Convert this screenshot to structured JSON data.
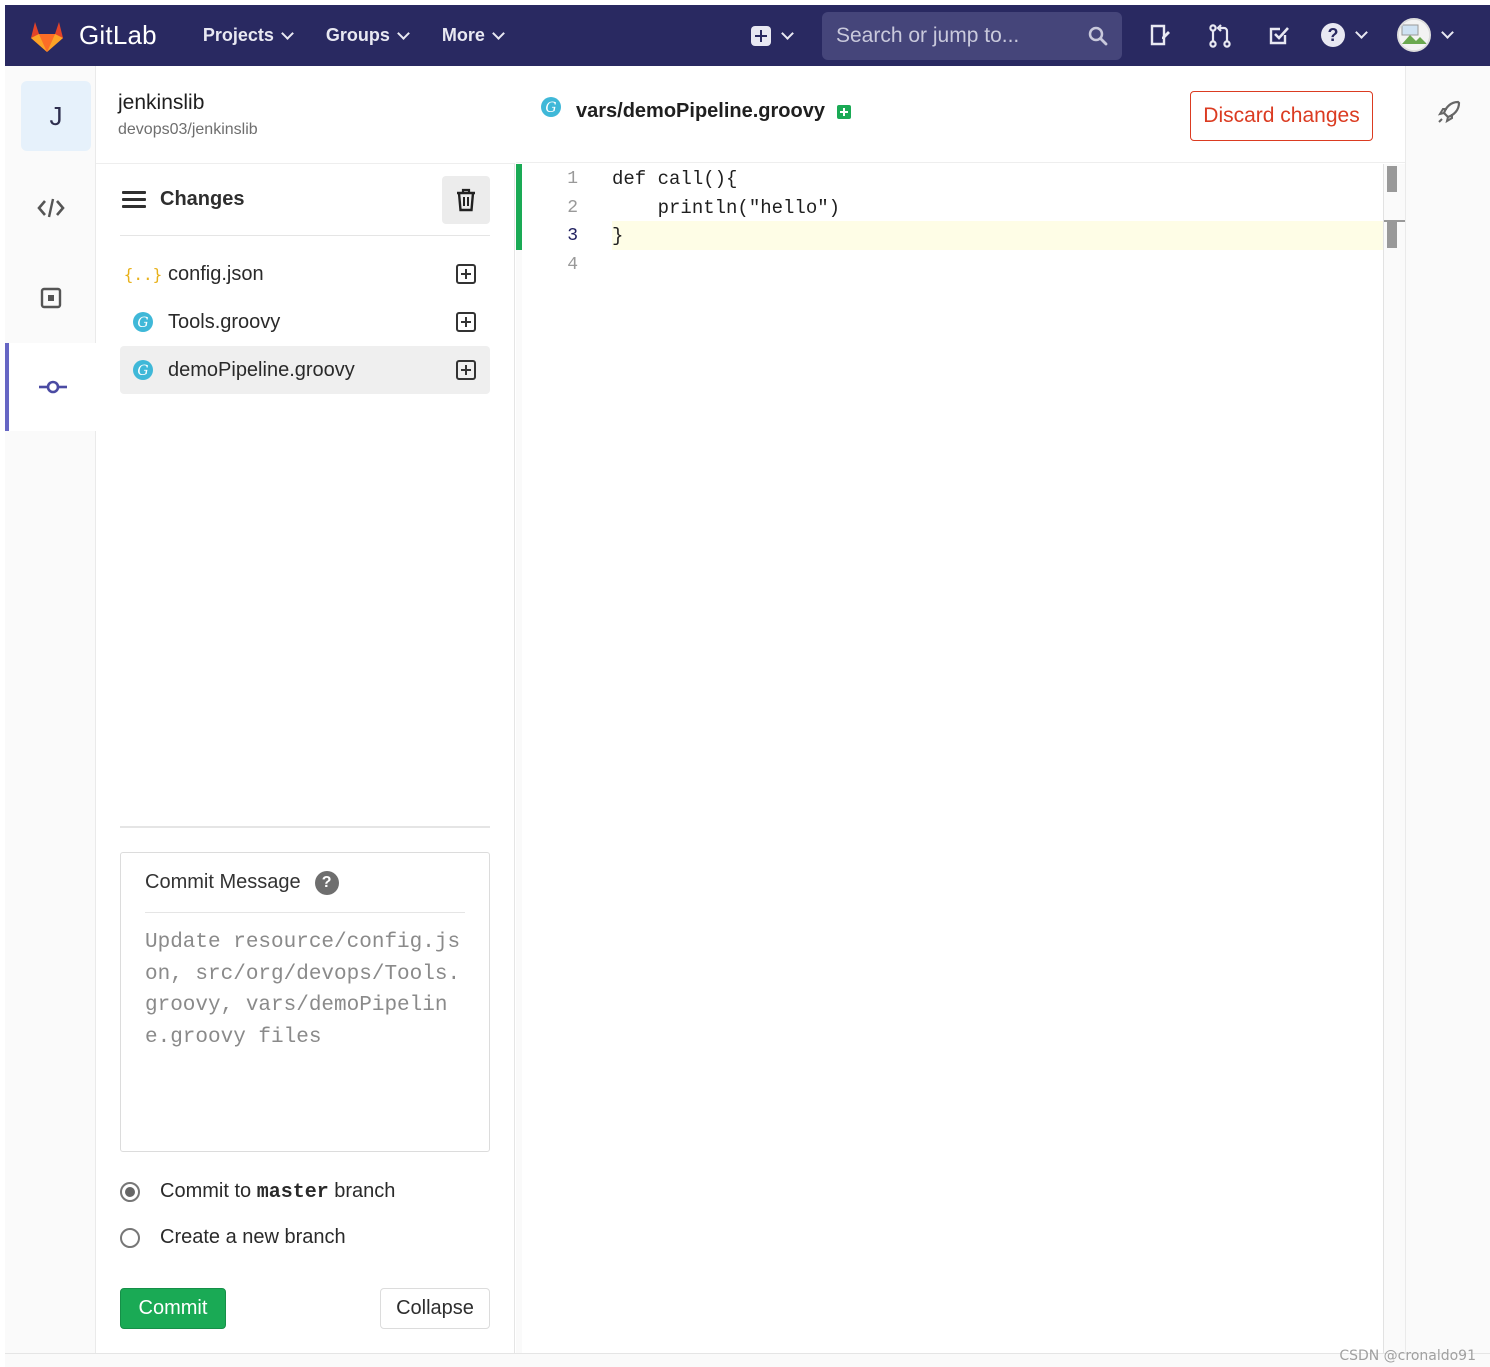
{
  "navbar": {
    "brand": "GitLab",
    "menu": [
      {
        "label": "Projects"
      },
      {
        "label": "Groups"
      },
      {
        "label": "More"
      }
    ],
    "search_placeholder": "Search or jump to...",
    "brand_color": "#292961"
  },
  "project": {
    "avatar_letter": "J",
    "name": "jenkinslib",
    "path": "devops03/jenkinslib"
  },
  "changes_panel": {
    "title": "Changes",
    "files": [
      {
        "name": "config.json",
        "icon": "json-file-icon",
        "selected": false
      },
      {
        "name": "Tools.groovy",
        "icon": "groovy-file-icon",
        "selected": false
      },
      {
        "name": "demoPipeline.groovy",
        "icon": "groovy-file-icon",
        "selected": true
      }
    ]
  },
  "commit": {
    "message_label": "Commit Message",
    "message_placeholder": "Update resource/config.json, src/org/devops/Tools.groovy, vars/demoPipeline.groovy files",
    "option_master_prefix": "Commit to ",
    "option_master_branch": "master",
    "option_master_suffix": " branch",
    "option_new_branch": "Create a new branch",
    "commit_button": "Commit",
    "collapse_button": "Collapse"
  },
  "editor": {
    "file_path": "vars/demoPipeline.groovy",
    "discard_button": "Discard changes",
    "line_numbers": [
      "1",
      "2",
      "3",
      "4"
    ],
    "current_line": "3",
    "code_lines": [
      "def call(){",
      "    println(\"hello\")",
      "}",
      ""
    ]
  },
  "watermark": "CSDN @cronaldo91",
  "colors": {
    "accent_green": "#1aaa55",
    "danger_red": "#db3b21",
    "active_indigo": "#6666c4"
  }
}
